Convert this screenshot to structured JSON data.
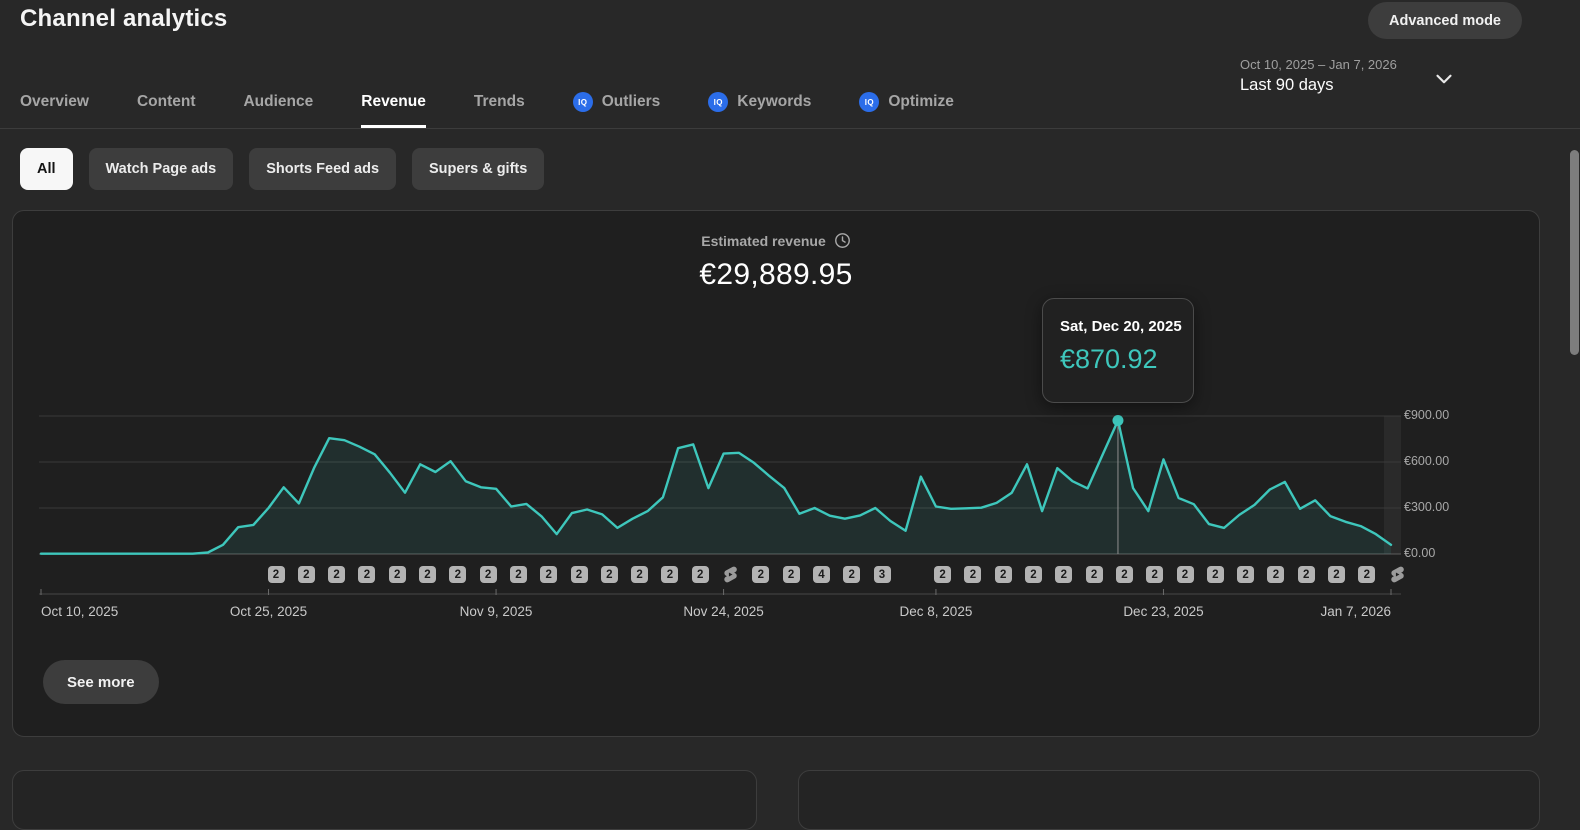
{
  "page": {
    "title": "Channel analytics"
  },
  "header": {
    "advanced_mode_label": "Advanced mode"
  },
  "tabs": [
    {
      "label": "Overview",
      "active": false,
      "iq": false
    },
    {
      "label": "Content",
      "active": false,
      "iq": false
    },
    {
      "label": "Audience",
      "active": false,
      "iq": false
    },
    {
      "label": "Revenue",
      "active": true,
      "iq": false
    },
    {
      "label": "Trends",
      "active": false,
      "iq": false
    },
    {
      "label": "Outliers",
      "active": false,
      "iq": true
    },
    {
      "label": "Keywords",
      "active": false,
      "iq": true
    },
    {
      "label": "Optimize",
      "active": false,
      "iq": true
    }
  ],
  "iq_icon_label": "IQ",
  "date_range": {
    "range_text": "Oct 10, 2025 – Jan 7, 2026",
    "preset": "Last 90 days"
  },
  "filters": [
    {
      "label": "All",
      "selected": true
    },
    {
      "label": "Watch Page ads",
      "selected": false
    },
    {
      "label": "Shorts Feed ads",
      "selected": false
    },
    {
      "label": "Supers & gifts",
      "selected": false
    }
  ],
  "metric_card": {
    "title": "Estimated revenue",
    "total": "€29,889.95",
    "see_more_label": "See more",
    "tooltip": {
      "date": "Sat, Dec 20, 2025",
      "value": "€870.92"
    }
  },
  "chart_data": {
    "type": "area",
    "title": "Estimated revenue",
    "currency": "EUR",
    "x_start": "Oct 10, 2025",
    "x_end": "Jan 7, 2026",
    "x_unit": "day",
    "x_tick_labels": [
      "Oct 10, 2025",
      "Oct 25, 2025",
      "Nov 9, 2025",
      "Nov 24, 2025",
      "Dec 8, 2025",
      "Dec 23, 2025",
      "Jan 7, 2026"
    ],
    "x_tick_days": [
      0,
      15,
      30,
      45,
      59,
      74,
      89
    ],
    "y_tick_labels": [
      "€900.00",
      "€600.00",
      "€300.00",
      "€0.00"
    ],
    "y_tick_values": [
      900,
      600,
      300,
      0
    ],
    "ylim": [
      0,
      900
    ],
    "grid": true,
    "legend_position": "none",
    "highlight": {
      "day": 71,
      "date": "Sat, Dec 20, 2025",
      "value": 870.92
    },
    "values": [
      2,
      2,
      2,
      2,
      2,
      2,
      2,
      2,
      2,
      2,
      2,
      10,
      60,
      175,
      190,
      300,
      435,
      330,
      560,
      755,
      742,
      700,
      650,
      530,
      400,
      585,
      535,
      605,
      475,
      435,
      425,
      310,
      327,
      245,
      130,
      267,
      290,
      258,
      170,
      230,
      280,
      370,
      690,
      715,
      430,
      655,
      660,
      595,
      510,
      430,
      262,
      300,
      250,
      230,
      252,
      300,
      215,
      152,
      505,
      310,
      295,
      298,
      302,
      333,
      400,
      585,
      280,
      560,
      475,
      428,
      650,
      870.92,
      430,
      280,
      617,
      365,
      325,
      195,
      170,
      255,
      320,
      420,
      470,
      295,
      350,
      247,
      210,
      182,
      130,
      60
    ]
  },
  "upload_markers": [
    "2",
    "2",
    "2",
    "2",
    "2",
    "2",
    "2",
    "2",
    "2",
    "2",
    "2",
    "2",
    "2",
    "2",
    "2",
    "shorts",
    "2",
    "2",
    "4",
    "2",
    "3",
    "",
    "2",
    "2",
    "2",
    "2",
    "2",
    "2",
    "2",
    "2",
    "2",
    "2",
    "2",
    "2",
    "2",
    "2",
    "2",
    "shorts"
  ],
  "colors": {
    "accent_teal": "#3ec7bc",
    "iq_blue": "#2b6de9",
    "line": "#3ec7bc",
    "area_fill": "rgba(62,199,188,0.10)",
    "grid_line": "#3a3a3a",
    "axis_line": "#5e5e5e",
    "marker_bg": "#b3b3b3"
  }
}
